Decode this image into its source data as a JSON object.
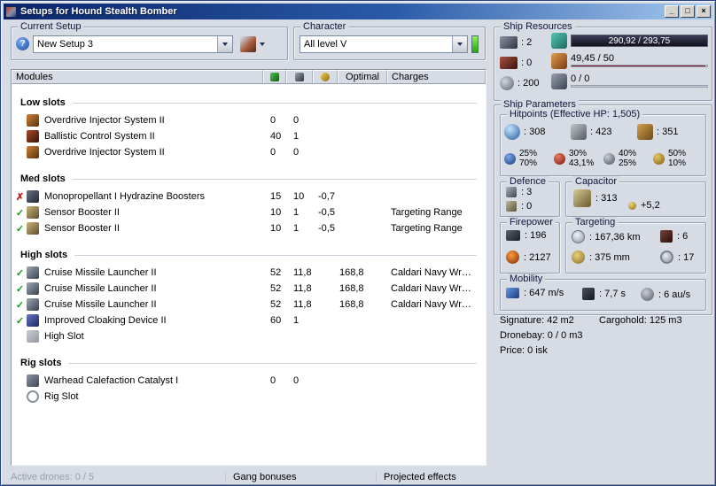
{
  "window": {
    "title": "Setups for Hound Stealth Bomber",
    "minimize_glyph": "_",
    "maximize_glyph": "□",
    "close_glyph": "×"
  },
  "icons": {
    "help": "?",
    "status_ok": "✓",
    "status_error": "✗"
  },
  "current_setup": {
    "group_label": "Current Setup",
    "combo_value": "New Setup 3"
  },
  "character": {
    "group_label": "Character",
    "combo_value": "All level V"
  },
  "modules": {
    "header": {
      "modules": "Modules",
      "optimal": "Optimal",
      "charges": "Charges"
    },
    "sections": {
      "low": "Low slots",
      "med": "Med slots",
      "high": "High slots",
      "rig": "Rig slots"
    },
    "rows": [
      {
        "name": "Overdrive Injector System II",
        "cpu": "0",
        "pg": "0",
        "cap": "",
        "optimal": "",
        "charges": ""
      },
      {
        "name": "Ballistic Control System II",
        "cpu": "40",
        "pg": "1",
        "cap": "",
        "optimal": "",
        "charges": ""
      },
      {
        "name": "Overdrive Injector System II",
        "cpu": "0",
        "pg": "0",
        "cap": "",
        "optimal": "",
        "charges": ""
      },
      {
        "name": "Monopropellant I Hydrazine Boosters",
        "cpu": "15",
        "pg": "10",
        "cap": "-0,7",
        "optimal": "",
        "charges": ""
      },
      {
        "name": "Sensor Booster II",
        "cpu": "10",
        "pg": "1",
        "cap": "-0,5",
        "optimal": "",
        "charges": "Targeting Range"
      },
      {
        "name": "Sensor Booster II",
        "cpu": "10",
        "pg": "1",
        "cap": "-0,5",
        "optimal": "",
        "charges": "Targeting Range"
      },
      {
        "name": "Cruise Missile Launcher II",
        "cpu": "52",
        "pg": "11,8",
        "cap": "",
        "optimal": "168,8",
        "charges": "Caldari Navy Wr…"
      },
      {
        "name": "Cruise Missile Launcher II",
        "cpu": "52",
        "pg": "11,8",
        "cap": "",
        "optimal": "168,8",
        "charges": "Caldari Navy Wr…"
      },
      {
        "name": "Cruise Missile Launcher II",
        "cpu": "52",
        "pg": "11,8",
        "cap": "",
        "optimal": "168,8",
        "charges": "Caldari Navy Wr…"
      },
      {
        "name": "Improved Cloaking Device II",
        "cpu": "60",
        "pg": "1",
        "cap": "",
        "optimal": "",
        "charges": ""
      },
      {
        "name": "High Slot",
        "cpu": "",
        "pg": "",
        "cap": "",
        "optimal": "",
        "charges": ""
      },
      {
        "name": "Warhead Calefaction Catalyst I",
        "cpu": "0",
        "pg": "0",
        "cap": "",
        "optimal": "",
        "charges": ""
      },
      {
        "name": "Rig Slot",
        "cpu": "",
        "pg": "",
        "cap": "",
        "optimal": "",
        "charges": ""
      }
    ]
  },
  "status_bar": {
    "active_drones": "Active drones: 0 / 5",
    "gang_bonuses": "Gang bonuses",
    "projected_effects": "Projected effects"
  },
  "ship_resources": {
    "group_label": "Ship Resources",
    "turret_hardpoints": ": 2",
    "launcher_hardpoints": ": 0",
    "calibration": ": 200",
    "cpu": "290,92 / 293,75",
    "powergrid": "49,45 / 50",
    "dronebay": "0 / 0"
  },
  "ship_parameters": {
    "group_label": "Ship Parameters",
    "hitpoints": {
      "group_label": "Hitpoints (Effective HP: 1,505)",
      "shield": ": 308",
      "armor": ": 423",
      "structure": ": 351",
      "resists": [
        {
          "shield": "25%",
          "armor": "70%"
        },
        {
          "shield": "30%",
          "armor": "43,1%"
        },
        {
          "shield": "40%",
          "armor": "25%"
        },
        {
          "shield": "50%",
          "armor": "10%"
        }
      ]
    },
    "defence": {
      "group_label": "Defence",
      "shield_rate": ": 3",
      "armor_rate": ": 0"
    },
    "capacitor": {
      "group_label": "Capacitor",
      "capacity": ": 313",
      "recharge": "+5,2"
    },
    "firepower": {
      "group_label": "Firepower",
      "dps": ": 196",
      "volley": ": 2127"
    },
    "targeting": {
      "group_label": "Targeting",
      "range": ": 167,36 km",
      "max_targets": ": 6",
      "scan_resolution": ": 375 mm",
      "sensor_strength": ": 17"
    },
    "mobility": {
      "group_label": "Mobility",
      "speed": ": 647 m/s",
      "align_time": ": 7,7 s",
      "warp_speed": ": 6 au/s"
    },
    "signature": "Signature: 42 m2",
    "cargohold": "Cargohold: 125 m3",
    "dronebay": "Dronebay: 0 / 0 m3",
    "price": "Price: 0 isk"
  }
}
